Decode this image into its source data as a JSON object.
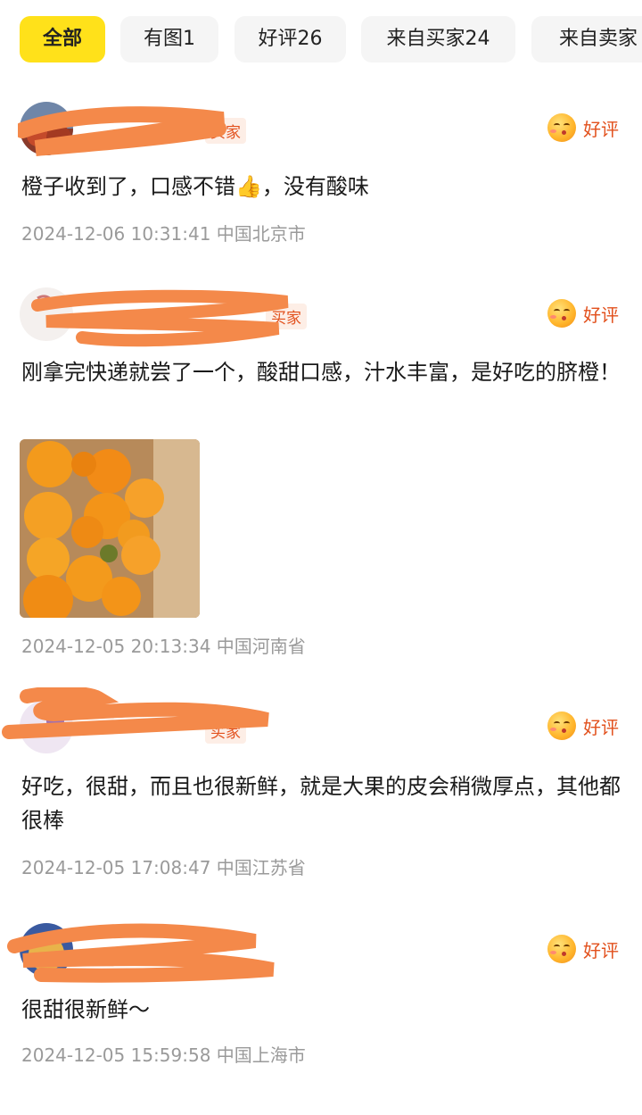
{
  "tabs": [
    {
      "label": "全部",
      "active": true
    },
    {
      "label": "有图1",
      "active": false
    },
    {
      "label": "好评26",
      "active": false
    },
    {
      "label": "来自买家24",
      "active": false
    },
    {
      "label": "来自卖家",
      "active": false
    }
  ],
  "reviews": [
    {
      "tag": "买家",
      "rating": "好评",
      "content": "橙子收到了，口感不错👍，没有酸味",
      "date": "2024-12-06 10:31:41",
      "location": "中国北京市"
    },
    {
      "tag": "买家",
      "rating": "好评",
      "content": "刚拿完快递就尝了一个，酸甜口感，汁水丰富，是好吃的脐橙！",
      "date": "2024-12-05 20:13:34",
      "location": "中国河南省",
      "photo_icon": "orange-photo"
    },
    {
      "tag": "买家",
      "rating": "好评",
      "content": "好吃，很甜，而且也很新鲜，就是大果的皮会稍微厚点，其他都很棒",
      "date": "2024-12-05 17:08:47",
      "location": "中国江苏省"
    },
    {
      "rating": "好评",
      "content": "很甜很新鲜～",
      "date": "2024-12-05 15:59:58",
      "location": "中国上海市"
    }
  ],
  "colors": {
    "accent": "#ffe11a",
    "rating": "#e2501c",
    "redaction": "#f4894a"
  }
}
